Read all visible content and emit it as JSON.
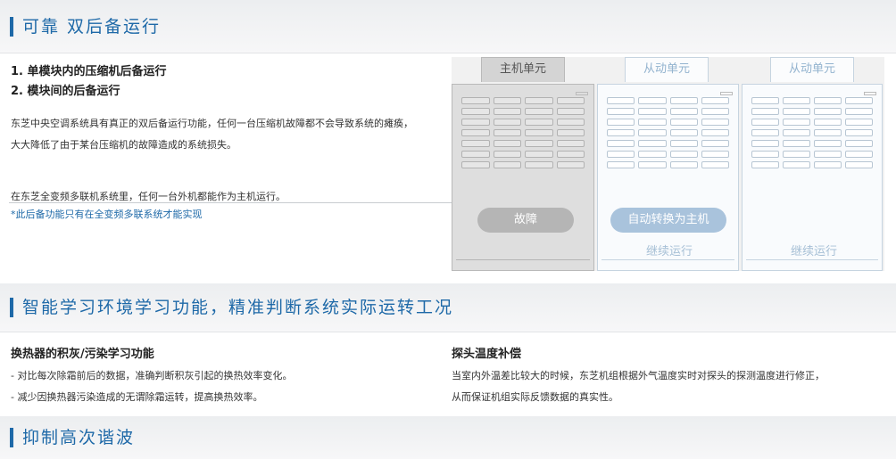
{
  "section1": {
    "title": "可靠 双后备运行",
    "items": [
      "1. 单模块内的压缩机后备运行",
      "2. 模块间的后备运行"
    ],
    "desc_lines": [
      "东芝中央空调系统具有真正的双后备运行功能，任何一台压缩机故障都不会导致系统的瘫痪，",
      "大大降低了由于某台压缩机的故障造成的系统损失。"
    ],
    "desc2": "在东芝全变频多联机系统里，任何一台外机都能作为主机运行。",
    "note": "*此后备功能只有在全变频多联系统才能实现"
  },
  "illustration": {
    "main_label": "主机单元",
    "follow_label_1": "从动单元",
    "follow_label_2": "从动单元",
    "fault": "故障",
    "auto_switch": "自动转换为主机",
    "continue_1": "继续运行",
    "continue_2": "继续运行"
  },
  "section2": {
    "title": "智能学习环境学习功能，精准判断系统实际运转工况",
    "left_heading": "换热器的积灰/污染学习功能",
    "left_lines": [
      "- 对比每次除霜前后的数据，准确判断积灰引起的换热效率变化。",
      "- 减少因换热器污染造成的无谓除霜运转，提高换热效率。"
    ],
    "right_heading": "探头温度补偿",
    "right_lines": [
      "当室内外温差比较大的时候，东芝机组根据外气温度实时对探头的探测温度进行修正，",
      "从而保证机组实际反馈数据的真实性。"
    ]
  },
  "section3": {
    "title": "抑制高次谐波"
  }
}
